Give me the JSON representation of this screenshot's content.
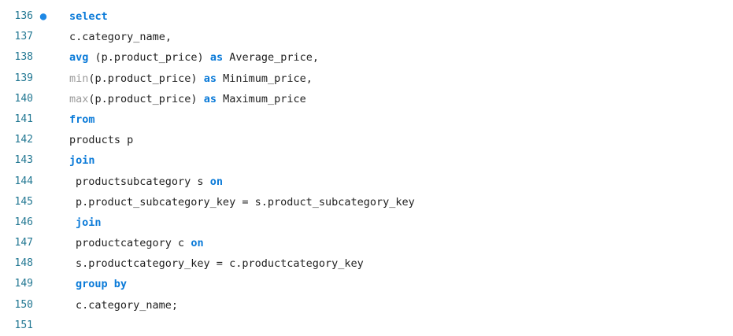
{
  "editor": {
    "active_line_marker": "●",
    "lines": [
      {
        "number": "136",
        "tokens": [
          {
            "t": "kw",
            "v": "select"
          }
        ]
      },
      {
        "number": "137",
        "tokens": [
          {
            "t": "txt",
            "v": "c.category_name,"
          }
        ]
      },
      {
        "number": "138",
        "tokens": [
          {
            "t": "fn-kw",
            "v": "avg"
          },
          {
            "t": "txt",
            "v": " (p.product_price) "
          },
          {
            "t": "kw",
            "v": "as"
          },
          {
            "t": "txt",
            "v": " Average_price,"
          }
        ]
      },
      {
        "number": "139",
        "tokens": [
          {
            "t": "fn",
            "v": "min"
          },
          {
            "t": "txt",
            "v": "(p.product_price) "
          },
          {
            "t": "kw",
            "v": "as"
          },
          {
            "t": "txt",
            "v": " Minimum_price,"
          }
        ]
      },
      {
        "number": "140",
        "tokens": [
          {
            "t": "fn",
            "v": "max"
          },
          {
            "t": "txt",
            "v": "(p.product_price) "
          },
          {
            "t": "kw",
            "v": "as"
          },
          {
            "t": "txt",
            "v": " Maximum_price"
          }
        ]
      },
      {
        "number": "141",
        "tokens": [
          {
            "t": "kw",
            "v": "from"
          }
        ]
      },
      {
        "number": "142",
        "tokens": [
          {
            "t": "txt",
            "v": "products p"
          }
        ]
      },
      {
        "number": "143",
        "tokens": [
          {
            "t": "kw",
            "v": "join"
          }
        ]
      },
      {
        "number": "144",
        "indent": true,
        "tokens": [
          {
            "t": "txt",
            "v": "productsubcategory s "
          },
          {
            "t": "kw",
            "v": "on"
          }
        ]
      },
      {
        "number": "145",
        "indent": true,
        "tokens": [
          {
            "t": "txt",
            "v": "p.product_subcategory_key = s.product_subcategory_key"
          }
        ]
      },
      {
        "number": "146",
        "indent": true,
        "tokens": [
          {
            "t": "kw",
            "v": "join"
          }
        ]
      },
      {
        "number": "147",
        "indent": true,
        "tokens": [
          {
            "t": "txt",
            "v": "productcategory c "
          },
          {
            "t": "kw",
            "v": "on"
          }
        ]
      },
      {
        "number": "148",
        "indent": true,
        "tokens": [
          {
            "t": "txt",
            "v": "s.productcategory_key = c.productcategory_key"
          }
        ]
      },
      {
        "number": "149",
        "indent": true,
        "tokens": [
          {
            "t": "kw",
            "v": "group by"
          }
        ]
      },
      {
        "number": "150",
        "indent": true,
        "tokens": [
          {
            "t": "txt",
            "v": "c.category_name;"
          }
        ]
      },
      {
        "number": "151",
        "tokens": []
      }
    ]
  }
}
